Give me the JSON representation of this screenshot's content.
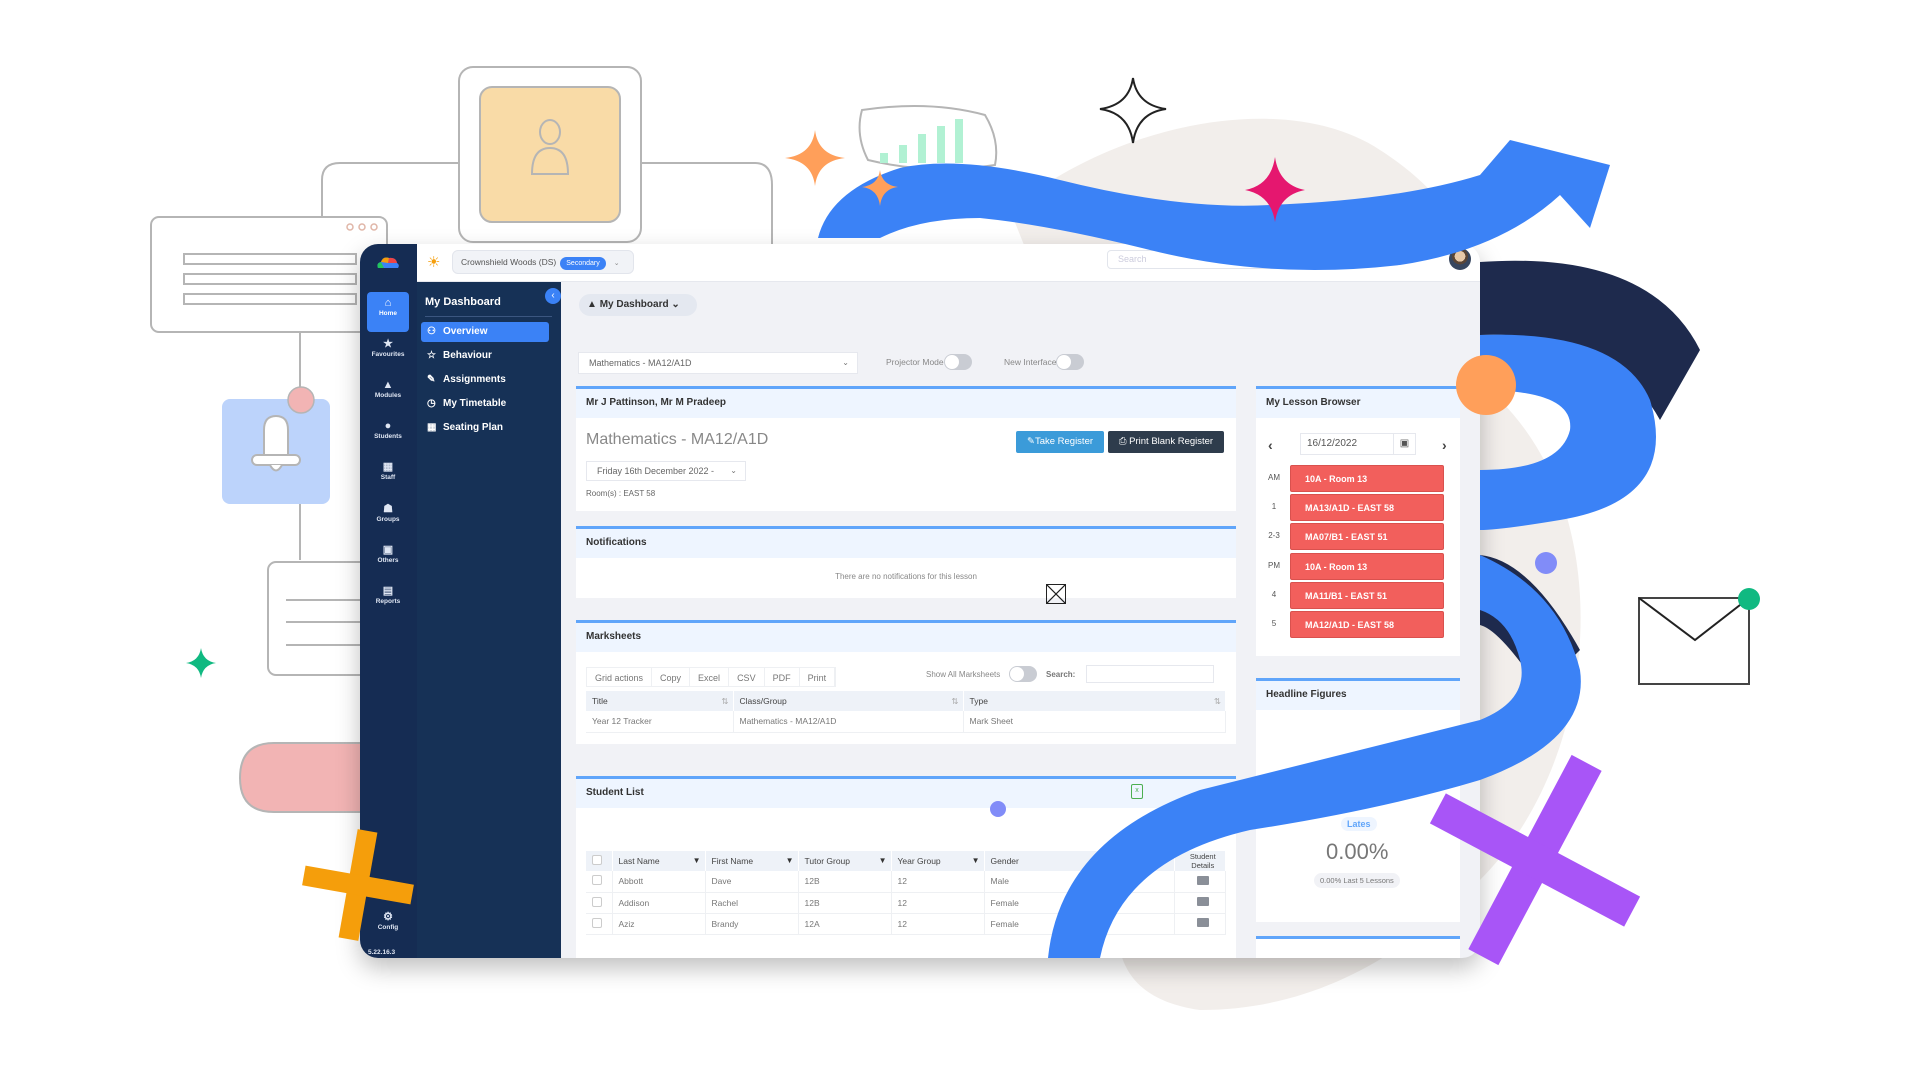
{
  "app": {
    "school_name": "Crownshield Woods (DS)",
    "school_badge": "Secondary",
    "search_placeholder": "Search",
    "version": "5.22.16.3"
  },
  "rail": {
    "items": [
      {
        "label": "Home",
        "icon": "home-icon",
        "active": true
      },
      {
        "label": "Favourites",
        "icon": "star-icon"
      },
      {
        "label": "Modules",
        "icon": "modules-icon"
      },
      {
        "label": "Students",
        "icon": "student-icon"
      },
      {
        "label": "Staff",
        "icon": "staff-icon"
      },
      {
        "label": "Groups",
        "icon": "groups-icon"
      },
      {
        "label": "Others",
        "icon": "others-icon"
      },
      {
        "label": "Reports",
        "icon": "report-icon"
      }
    ],
    "config_label": "Config"
  },
  "sidebar": {
    "title": "My Dashboard",
    "items": [
      {
        "label": "Overview",
        "icon": "users-icon",
        "active": true
      },
      {
        "label": "Behaviour",
        "icon": "star-icon"
      },
      {
        "label": "Assignments",
        "icon": "pen-icon"
      },
      {
        "label": "My Timetable",
        "icon": "clock-icon"
      },
      {
        "label": "Seating Plan",
        "icon": "grid-icon"
      }
    ]
  },
  "main": {
    "dashboard_button": "My Dashboard",
    "class_select": "Mathematics - MA12/A1D",
    "projector_mode_label": "Projector Mode",
    "new_interface_label": "New Interface",
    "lesson_panel": {
      "header": "Mr J Pattinson, Mr M Pradeep",
      "title": "Mathematics - MA12/A1D",
      "take_register": "Take Register",
      "print_blank_register": "Print Blank Register",
      "date_select": "Friday 16th December 2022 -",
      "rooms": "Room(s) : EAST 58"
    },
    "notifications": {
      "header": "Notifications",
      "empty_text": "There are no notifications for this lesson"
    },
    "marksheets": {
      "header": "Marksheets",
      "grid_actions": [
        "Grid actions",
        "Copy",
        "Excel",
        "CSV",
        "PDF",
        "Print"
      ],
      "show_all_label": "Show All Marksheets",
      "search_label": "Search:",
      "columns": [
        "Title",
        "Class/Group",
        "Type"
      ],
      "rows": [
        [
          "Year 12 Tracker",
          "Mathematics - MA12/A1D",
          "Mark Sheet"
        ]
      ]
    },
    "student_list": {
      "header": "Student List",
      "columns": [
        "Last Name",
        "First Name",
        "Tutor Group",
        "Year Group",
        "Gender",
        "Student Details"
      ],
      "rows": [
        [
          "Abbott",
          "Dave",
          "12B",
          "12",
          "Male"
        ],
        [
          "Addison",
          "Rachel",
          "12B",
          "12",
          "Female"
        ],
        [
          "Aziz",
          "Brandy",
          "12A",
          "12",
          "Female"
        ]
      ]
    }
  },
  "lesson_browser": {
    "header": "My Lesson Browser",
    "date": "16/12/2022",
    "lessons": [
      {
        "period": "AM",
        "label": "10A - Room 13"
      },
      {
        "period": "1",
        "label": "MA13/A1D - EAST 58"
      },
      {
        "period": "2-3",
        "label": "MA07/B1 - EAST 51"
      },
      {
        "period": "PM",
        "label": "10A - Room 13"
      },
      {
        "period": "4",
        "label": "MA11/B1 - EAST 51"
      },
      {
        "period": "5",
        "label": "MA12/A1D - EAST 58"
      }
    ]
  },
  "headline_figures": {
    "header": "Headline Figures",
    "partial_label": "ast 5 Lessons",
    "lates_label": "Lates",
    "lates_value": "0.00%",
    "lates_sub": "0.00% Last 5 Lessons"
  },
  "colors": {
    "accent_blue": "#3b82f6",
    "navy": "#152c53",
    "lesson_red": "#f25f5c"
  }
}
